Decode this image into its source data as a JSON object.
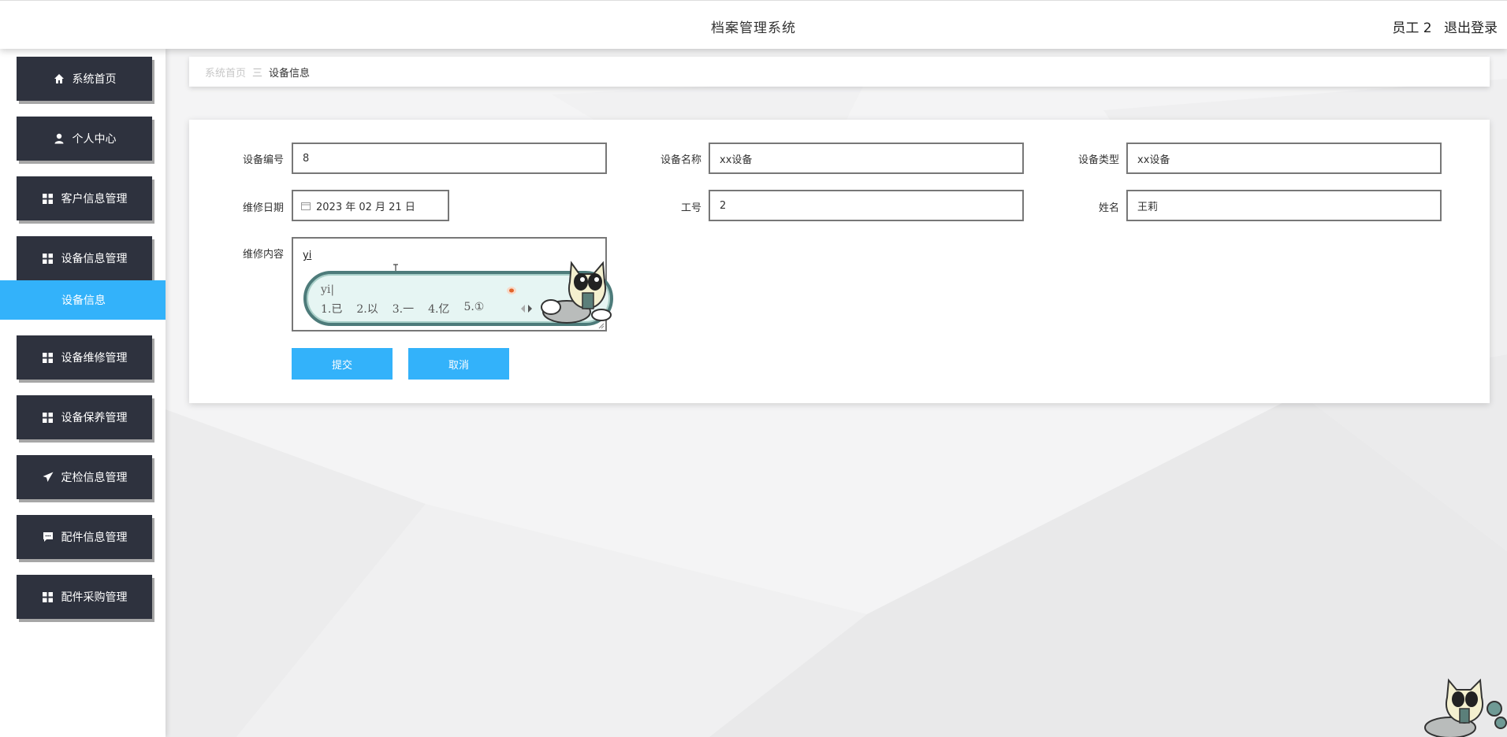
{
  "header": {
    "app_title": "档案管理系统",
    "user_name": "员工 2",
    "logout_label": "退出登录"
  },
  "sidebar": {
    "items": [
      {
        "label": "系统首页",
        "icon": "home-icon"
      },
      {
        "label": "个人中心",
        "icon": "user-icon"
      },
      {
        "label": "客户信息管理",
        "icon": "grid-icon"
      },
      {
        "label": "设备信息管理",
        "icon": "grid-icon"
      },
      {
        "label": "设备维修管理",
        "icon": "grid-icon"
      },
      {
        "label": "设备保养管理",
        "icon": "grid-icon"
      },
      {
        "label": "定检信息管理",
        "icon": "paper-plane-icon"
      },
      {
        "label": "配件信息管理",
        "icon": "chat-icon"
      },
      {
        "label": "配件采购管理",
        "icon": "grid-icon"
      }
    ],
    "submenu": {
      "label": "设备信息",
      "active": true
    }
  },
  "breadcrumb": {
    "home": "系统首页",
    "separator": "三",
    "current": "设备信息"
  },
  "form": {
    "device_no": {
      "label": "设备编号",
      "value": "8"
    },
    "device_name": {
      "label": "设备名称",
      "value": "xx设备"
    },
    "device_type": {
      "label": "设备类型",
      "value": "xx设备"
    },
    "repair_date": {
      "label": "维修日期",
      "value": "2023 年 02 月 21 日"
    },
    "worker_no": {
      "label": "工号",
      "value": "2"
    },
    "name": {
      "label": "姓名",
      "value": "王莉"
    },
    "repair_content": {
      "label": "维修内容",
      "value": "yi"
    },
    "submit_label": "提交",
    "cancel_label": "取消"
  },
  "ime": {
    "composition": "yi|",
    "candidates": [
      "1.已",
      "2.以",
      "3.一",
      "4.亿",
      "5.①"
    ]
  },
  "colors": {
    "primary": "#33b2fa",
    "sidebar_item": "#2e323e",
    "ime_border": "#4d7b7a",
    "ime_bg": "#e6f5f3"
  }
}
